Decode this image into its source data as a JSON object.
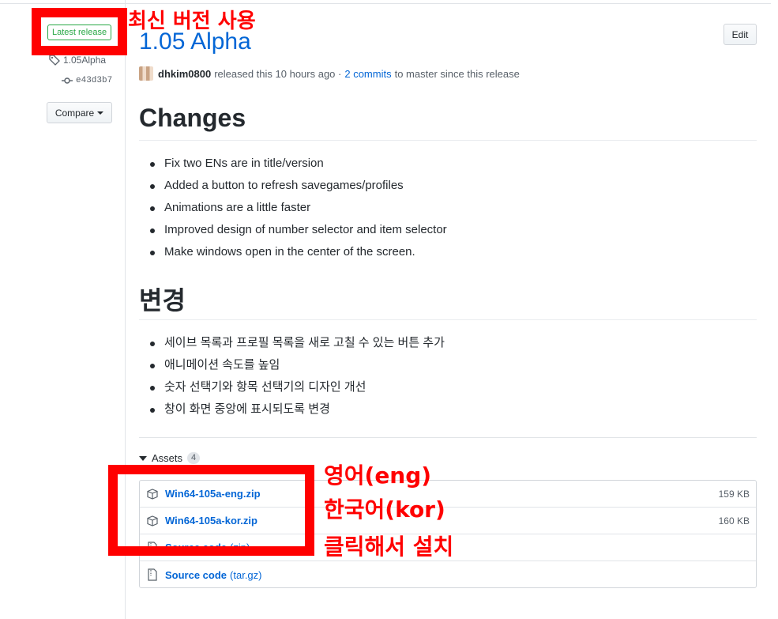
{
  "sidebar": {
    "latest_badge": "Latest release",
    "tag": "1.05Alpha",
    "commit": "e43d3b7",
    "compare_label": "Compare"
  },
  "release": {
    "title": "1.05 Alpha",
    "edit_label": "Edit",
    "author": "dhkim0800",
    "released_text": "released this 10 hours ago ·",
    "commits_link": "2 commits",
    "since_text": "to master since this release"
  },
  "notes_en": {
    "heading": "Changes",
    "items": [
      "Fix two ENs are in title/version",
      "Added a button to refresh savegames/profiles",
      "Animations are a little faster",
      "Improved design of number selector and item selector",
      "Make windows open in the center of the screen."
    ]
  },
  "notes_ko": {
    "heading": "변경",
    "items": [
      "세이브 목록과 프로필 목록을 새로 고칠 수 있는 버튼 추가",
      "애니메이션 속도를 높임",
      "숫자 선택기와 항목 선택기의 디자인 개선",
      "창이 화면 중앙에 표시되도록 변경"
    ]
  },
  "assets": {
    "label": "Assets",
    "count": "4",
    "files": [
      {
        "name": "Win64-105a-eng.zip",
        "size": "159 KB"
      },
      {
        "name": "Win64-105a-kor.zip",
        "size": "160 KB"
      }
    ],
    "sources": [
      {
        "name": "Source code",
        "ext": "(zip)"
      },
      {
        "name": "Source code",
        "ext": "(tar.gz)"
      }
    ]
  },
  "annotations": {
    "latest": "최신 버전 사용",
    "line1": "영어(eng)",
    "line2": "한국어(kor)",
    "line3": "클릭해서 설치",
    "color": "#ff0000"
  }
}
